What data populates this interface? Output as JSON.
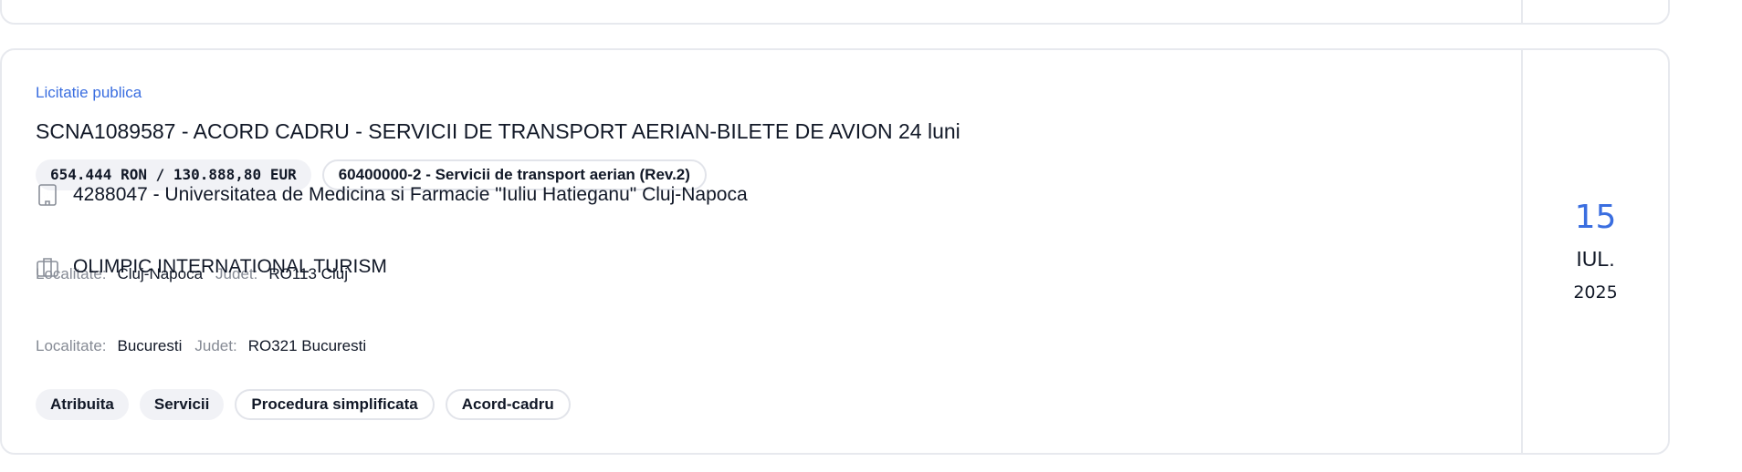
{
  "card": {
    "procedure_type": "Licitatie publica",
    "title": "SCNA1089587 - ACORD CADRU - SERVICII DE TRANSPORT AERIAN-BILETE DE AVION 24 luni",
    "value": "654.444 RON / 130.888,80 EUR",
    "cpv": "60400000-2 - Servicii de transport aerian (Rev.2)",
    "authority": {
      "icon": "building-icon",
      "name": "4288047 - Universitatea de Medicina si Farmacie \"Iuliu Hatieganu\" Cluj-Napoca",
      "localitate_label": "Localitate:",
      "localitate": "Cluj-Napoca",
      "judet_label": "Judet:",
      "judet": "RO113 Cluj"
    },
    "supplier": {
      "icon": "briefcase-icon",
      "name": "OLIMPIC INTERNATIONAL TURISM",
      "localitate_label": "Localitate:",
      "localitate": "Bucuresti",
      "judet_label": "Judet:",
      "judet": "RO321 Bucuresti"
    },
    "tags": [
      "Atribuita",
      "Servicii",
      "Procedura simplificata",
      "Acord-cadru"
    ],
    "date": {
      "day": "15",
      "month": "IUL.",
      "year": "2025"
    }
  },
  "colors": {
    "accent": "#3a6ee0",
    "border": "#e7e9ee",
    "chip_bg": "#f1f2f6"
  }
}
